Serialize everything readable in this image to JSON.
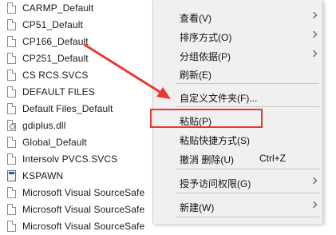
{
  "files": [
    {
      "name": "CARMP_Default",
      "icon": "file-icon"
    },
    {
      "name": "CP51_Default",
      "icon": "file-icon"
    },
    {
      "name": "CP166_Default",
      "icon": "file-icon"
    },
    {
      "name": "CP251_Default",
      "icon": "file-icon"
    },
    {
      "name": "CS RCS.SVCS",
      "icon": "file-icon"
    },
    {
      "name": "DEFAULT FILES",
      "icon": "file-icon"
    },
    {
      "name": "Default Files_Default",
      "icon": "file-icon"
    },
    {
      "name": "gdiplus.dll",
      "icon": "gear-file-icon"
    },
    {
      "name": "Global_Default",
      "icon": "file-icon"
    },
    {
      "name": "Intersolv PVCS.SVCS",
      "icon": "file-icon"
    },
    {
      "name": "KSPAWN",
      "icon": "application-icon"
    },
    {
      "name": "Microsoft Visual SourceSafe",
      "icon": "file-icon"
    },
    {
      "name": "Microsoft Visual SourceSafe",
      "icon": "file-icon"
    },
    {
      "name": "Microsoft Visual SourceSafe",
      "icon": "file-icon"
    }
  ],
  "right_column": [
    "",
    "",
    "",
    "",
    "",
    "",
    "",
    "",
    "",
    "",
    "",
    "",
    "",
    ""
  ],
  "menu": {
    "view": {
      "label": "查看(V)"
    },
    "sort_by": {
      "label": "排序方式(O)"
    },
    "group_by": {
      "label": "分组依据(P)"
    },
    "refresh": {
      "label": "刷新(E)"
    },
    "customize_folder": {
      "label": "自定义文件夹(F)..."
    },
    "paste": {
      "label": "粘贴(P)"
    },
    "paste_shortcut": {
      "label": "粘贴快捷方式(S)"
    },
    "undo_delete": {
      "label": "撤消 删除(U)",
      "shortcut": "Ctrl+Z"
    },
    "give_access": {
      "label": "授予访问权限(G)"
    },
    "new": {
      "label": "新建(W)"
    }
  },
  "annotation": {
    "color": "#e53935"
  }
}
